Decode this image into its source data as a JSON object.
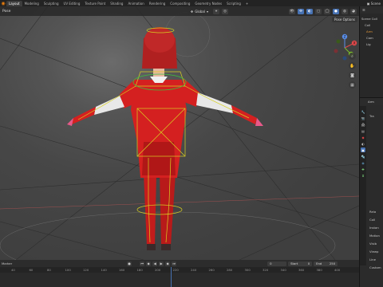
{
  "app": {
    "workspace_tabs": [
      "Layout",
      "Modeling",
      "Sculpting",
      "UV Editing",
      "Texture Paint",
      "Shading",
      "Animation",
      "Rendering",
      "Compositing",
      "Geometry Nodes",
      "Scripting",
      "+"
    ],
    "active_tab": "Layout",
    "scene_label": "Scene"
  },
  "viewport": {
    "mode": "Pose",
    "pivot": "Global",
    "pose_options": "Pose Options",
    "gizmo_axes": [
      "X",
      "Y",
      "Z"
    ]
  },
  "timeline": {
    "current_frame": "0",
    "start_label": "Start",
    "start_value": "0",
    "end_label": "End",
    "end_value": "250",
    "marker_label": "Marker",
    "ruler_ticks": [
      "40",
      "60",
      "80",
      "100",
      "120",
      "140",
      "160",
      "180",
      "200",
      "220",
      "240",
      "260",
      "280",
      "300",
      "320",
      "340",
      "360",
      "380",
      "400"
    ]
  },
  "outliner": {
    "rows": [
      "Scene Coll",
      "Coll",
      "Arm",
      "Cam",
      "Lig"
    ]
  },
  "properties": {
    "object_name": "Arm",
    "items": [
      "Tra",
      "Rela",
      "Coll",
      "Instan",
      "Motion",
      "Visib",
      "Viewp",
      "Line",
      "Custom"
    ]
  },
  "colors": {
    "accent": "#4772b3",
    "bone_outline": "#d8d020",
    "character_red": "#d42020",
    "blender_orange": "#e87d0d"
  }
}
